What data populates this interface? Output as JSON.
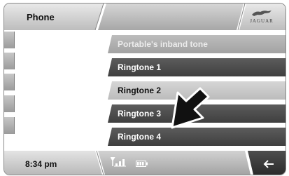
{
  "header": {
    "title": "Phone",
    "brand": "JAGUAR"
  },
  "menu": {
    "items": [
      {
        "label": "Portable's inband tone",
        "state": "disabled"
      },
      {
        "label": "Ringtone  1",
        "state": "normal"
      },
      {
        "label": "Ringtone  2",
        "state": "selected"
      },
      {
        "label": "Ringtone  3",
        "state": "normal"
      },
      {
        "label": "Ringtone  4",
        "state": "normal"
      }
    ]
  },
  "footer": {
    "time": "8:34 pm",
    "icons": [
      "signal-strength-icon",
      "battery-icon",
      "back-arrow-icon"
    ]
  },
  "colors": {
    "row_dark": "#4a4a4a",
    "row_selected": "#c9c9c9",
    "row_disabled": "#b0b0b0"
  }
}
